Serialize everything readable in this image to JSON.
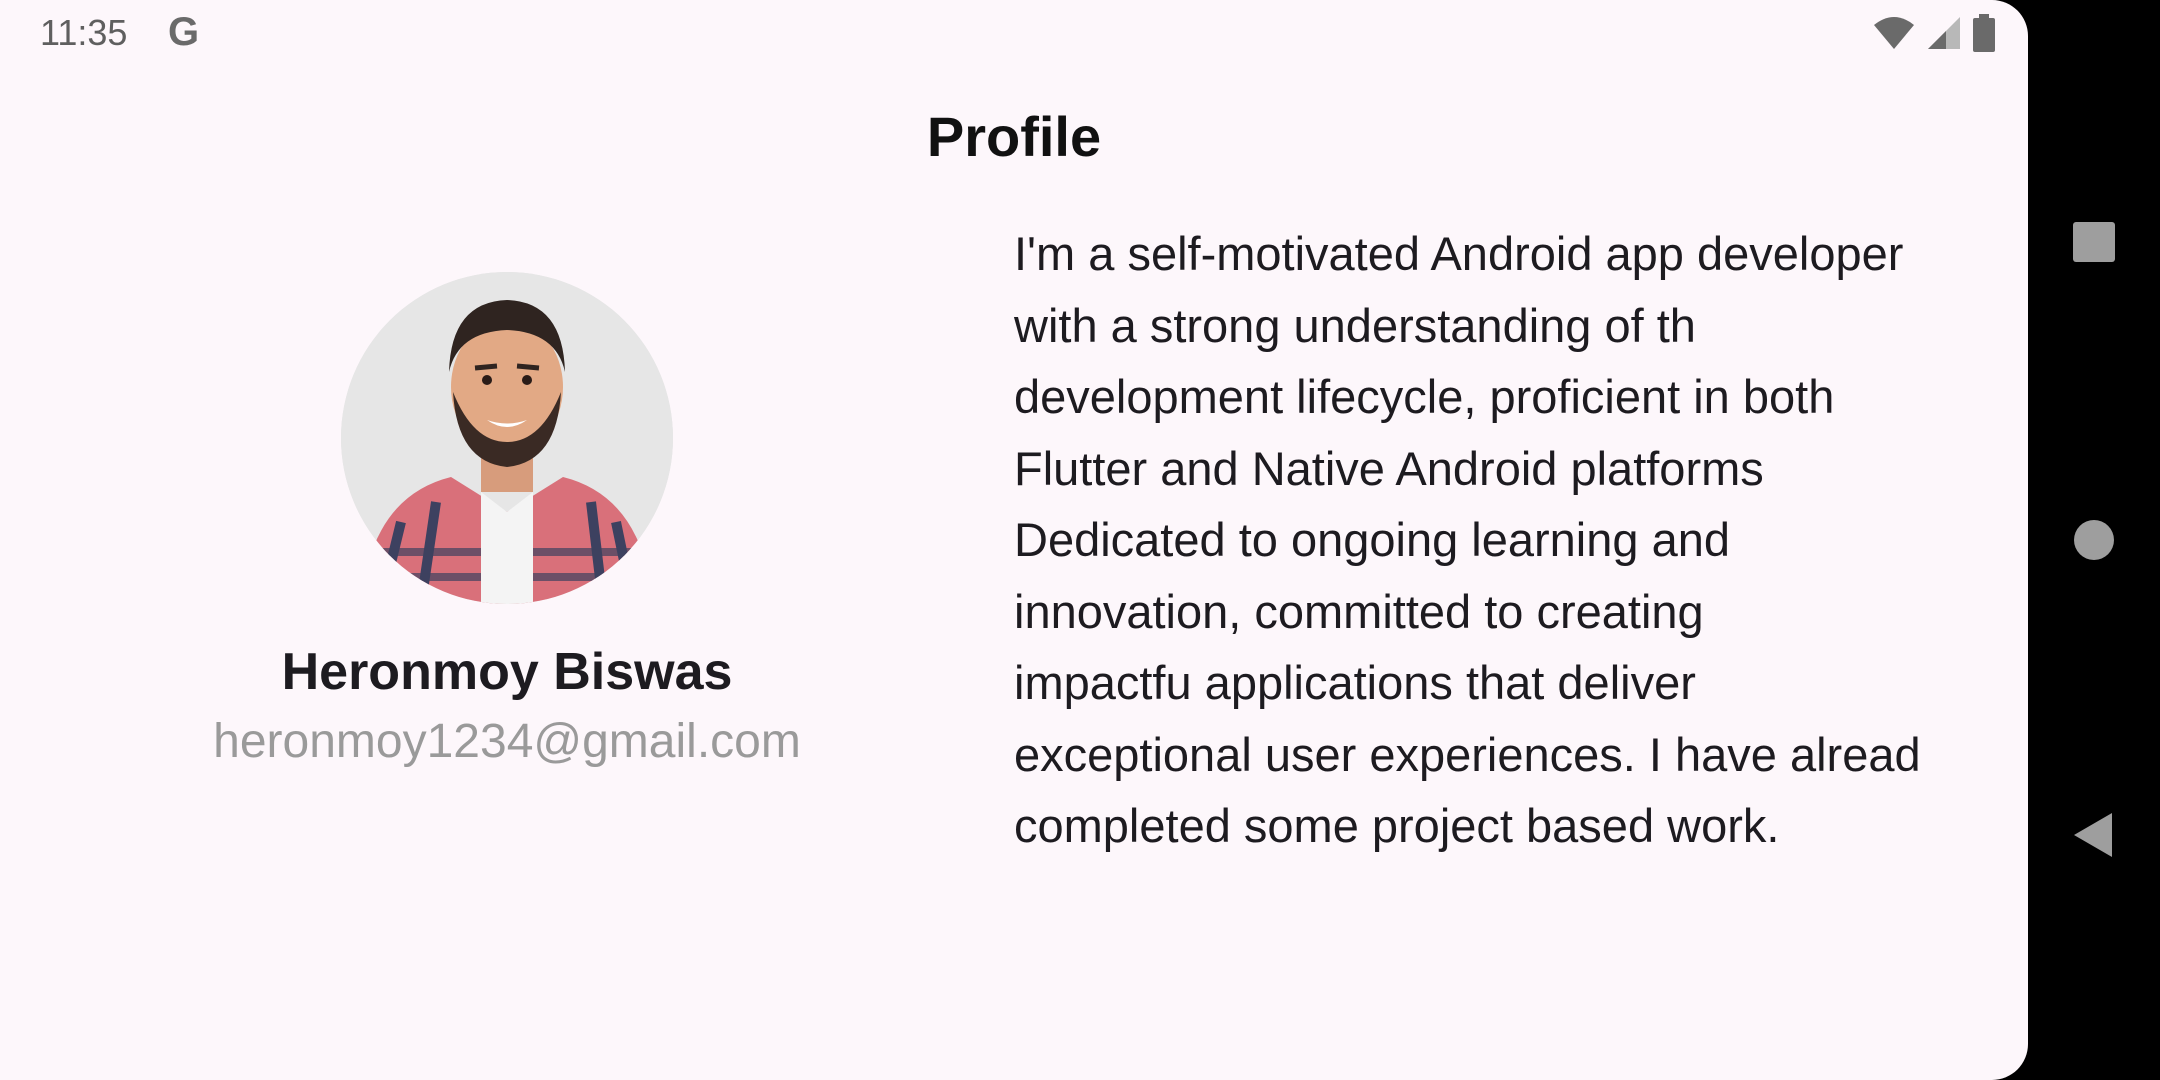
{
  "status_bar": {
    "time": "11:35",
    "google_badge": "G",
    "icons": [
      "wifi-icon",
      "signal-icon",
      "battery-icon"
    ]
  },
  "page": {
    "title": "Profile"
  },
  "profile": {
    "name": "Heronmoy Biswas",
    "email": "heronmoy1234@gmail.com",
    "avatar": "profile-photo"
  },
  "bio": {
    "text": "I'm a self-motivated Android app developer\nwith a strong understanding of th\ndevelopment lifecycle, proficient in both\nFlutter and Native Android platforms\nDedicated to ongoing learning and\ninnovation, committed to creating\nimpactfu applications that deliver\nexceptional user experiences. I have alread\ncompleted some project based work."
  },
  "navigation": {
    "buttons": [
      "recents-button",
      "home-button",
      "back-button"
    ]
  },
  "colors": {
    "background": "#fdf7fb",
    "text_primary": "#1d1b20",
    "text_secondary": "#9a9a9a",
    "nav_bar": "#000000",
    "nav_icon": "#9e9e9e"
  }
}
